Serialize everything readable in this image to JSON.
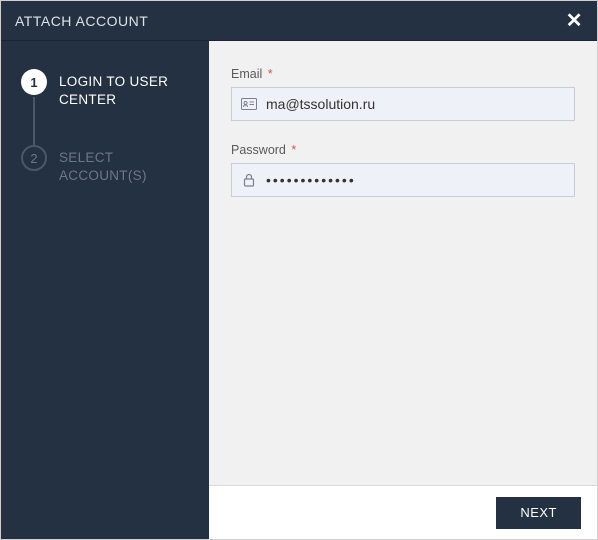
{
  "header": {
    "title": "ATTACH ACCOUNT"
  },
  "sidebar": {
    "steps": [
      {
        "num": "1",
        "label": "LOGIN TO USER CENTER"
      },
      {
        "num": "2",
        "label": "SELECT ACCOUNT(S)"
      }
    ]
  },
  "form": {
    "email": {
      "label": "Email",
      "required": "*",
      "value": "ma@tssolution.ru"
    },
    "password": {
      "label": "Password",
      "required": "*",
      "value": "•••••••••••••"
    }
  },
  "footer": {
    "next_label": "NEXT"
  }
}
